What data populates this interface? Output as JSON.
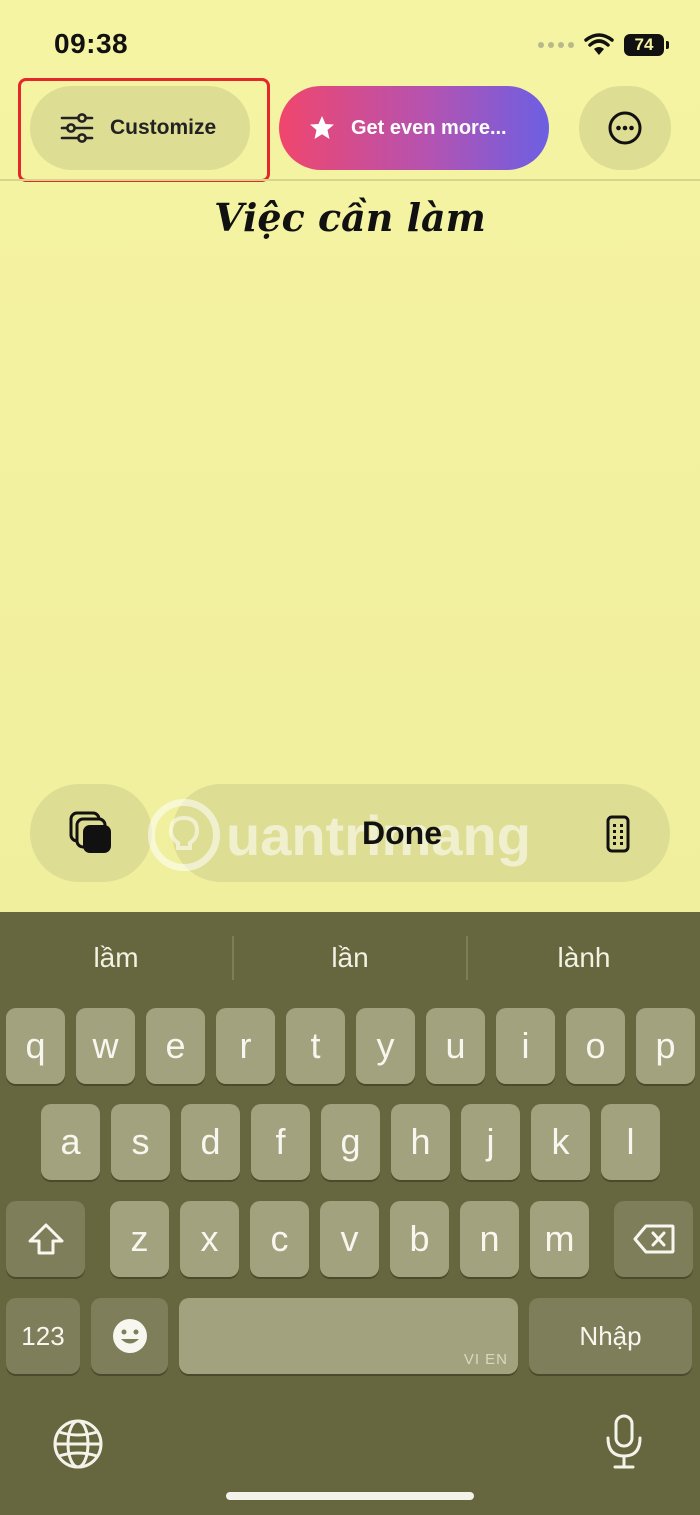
{
  "status_bar": {
    "time": "09:38",
    "battery": "74"
  },
  "toolbar": {
    "customize_label": "Customize",
    "get_more_label": "Get even more..."
  },
  "note": {
    "title": "Việc cần làm"
  },
  "editor_bar": {
    "done_label": "Done"
  },
  "watermark": {
    "text": "uantrimang"
  },
  "keyboard": {
    "suggestions": [
      "lầm",
      "lần",
      "lành"
    ],
    "row1": [
      "q",
      "w",
      "e",
      "r",
      "t",
      "y",
      "u",
      "i",
      "o",
      "p"
    ],
    "row2": [
      "a",
      "s",
      "d",
      "f",
      "g",
      "h",
      "j",
      "k",
      "l"
    ],
    "row3": [
      "z",
      "x",
      "c",
      "v",
      "b",
      "n",
      "m"
    ],
    "numbers_label": "123",
    "return_label": "Nhập",
    "space_hint": "VI EN"
  },
  "colors": {
    "note_background": "#f5f4a3",
    "keyboard_background": "#67673f",
    "highlight_border": "#e5262a",
    "promo_gradient_start": "#f0466d",
    "promo_gradient_end": "#6c5fe3"
  },
  "icons": [
    "sliders-icon",
    "star-icon",
    "more-icon",
    "stack-icon",
    "phone-icon",
    "shift-icon",
    "delete-icon",
    "emoji-icon",
    "globe-icon",
    "mic-icon"
  ]
}
